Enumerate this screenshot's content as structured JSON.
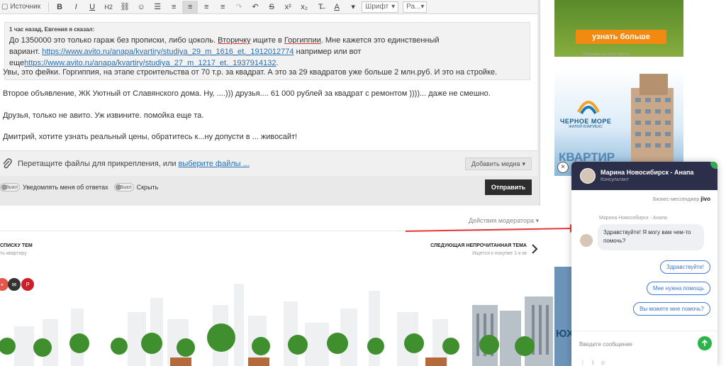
{
  "toolbar": {
    "source_label": "Источник",
    "buttons": [
      "B",
      "I",
      "U",
      "H2"
    ],
    "font_label": "Шрифт",
    "size_label": "Ра..."
  },
  "quote": {
    "header": "1 час назад, Евгения я сказал:",
    "line1_a": "До 1350000 это только гараж без прописки, либо цоколь. ",
    "line1_b": "Вторичку",
    "line1_c": " ищите в ",
    "line1_d": "Горгиппии",
    "line1_e": ". Мне кажется это единственный",
    "line2_a": "вариант. ",
    "line2_link": "https://www.avito.ru/anapa/kvartiry/studiya_29_m_1616_et._1912012774",
    "line2_b": " например или вот",
    "line3_a": "еще",
    "line3_link": "https://www.avito.ru/anapa/kvartiry/studiya_27_m_1217_et._1937914132",
    "line3_b": "."
  },
  "messages": [
    "Увы, это фейки. Горгиппия, на этапе строительства от 70 т.р. за квадрат. А это за 29 квадратов уже больше 2 млн.руб. И это на стройке.",
    "Второе объявление, ЖК Уютный от Славянского дома. Ну, ....))) друзья.... 61 000 рублей за квадрат с ремонтом ))))... даже не смешно.",
    "Друзья, только не авито. Уж извините. помойка еще та.",
    "Дмитрий, хотите узнать реальный цены, обратитесь к...ну допусти в ... живосайт!"
  ],
  "attach": {
    "text": "Перетащите файлы для прикрепления, или",
    "link": "выберите файлы ...",
    "media_button": "Добавить медиа"
  },
  "options": {
    "notify_label": "Уведомлять меня об ответах",
    "hide_label": "Скрыть",
    "toggle_state": "Выкл",
    "send_button": "Отправить"
  },
  "moderator_actions": "Действия модератора",
  "nav": {
    "prev_title": "СПИСКУ ТЕМ",
    "prev_sub": "ть квартиру",
    "next_title": "СЛЕДУЮЩАЯ НЕПРОЧИТАННАЯ ТЕМА",
    "next_sub": "Ищется к покупке 1-к кв"
  },
  "ads": {
    "top_button": "узнать больше",
    "top_caption": "Реклама на этом месте",
    "complex_name": "ЧЕРНОЕ МОРЕ",
    "complex_sub": "ЖИЛОЙ КОМПЛЕКС",
    "complex_promo": "КВАРТИР",
    "bottom_text": "ЮХ"
  },
  "chat": {
    "operator_name": "Марина Новосибирск - Анапа",
    "operator_role": "Консультант",
    "brand_text": "Бизнес-мессенджер",
    "brand_name": "jivo",
    "message_author": "Марина Новосибирск - Анапа",
    "message": "Здравствуйте! Я могу вам чем-то помочь?",
    "quick_replies": [
      "Здравствуйте!",
      "Мне нужна помощь",
      "Вы можете мне помочь?"
    ],
    "input_placeholder": "Введите сообщение"
  },
  "colors": {
    "chat_header": "#2c2f4a",
    "accent_blue": "#3c78d8",
    "send_green": "#2cb34a",
    "arrow_red": "#e53935",
    "ad_orange": "#f28a12"
  }
}
